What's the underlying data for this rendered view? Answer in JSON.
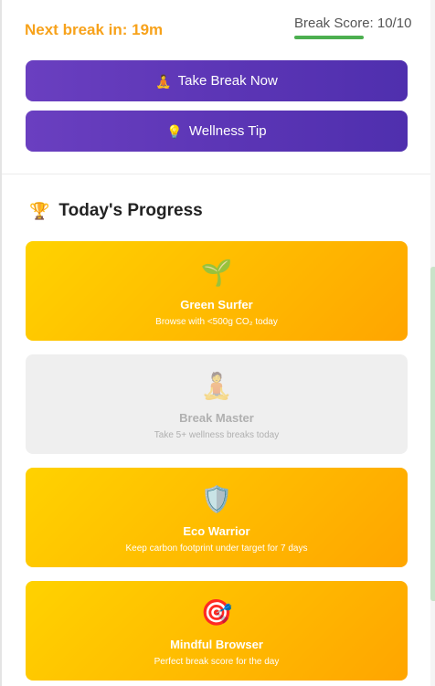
{
  "status": {
    "next_break": "Next break in: 19m",
    "score_label": "Break Score: 10/10",
    "score_fraction": 1.0,
    "score_color": "#4caf50"
  },
  "buttons": {
    "take_break": {
      "icon": "meditation-icon",
      "emoji": "🧘",
      "label": "Take Break Now"
    },
    "wellness_tip": {
      "icon": "lightbulb-icon",
      "emoji": "💡",
      "label": "Wellness Tip"
    }
  },
  "progress": {
    "icon": "trophy-icon",
    "emoji": "🏆",
    "title": "Today's Progress",
    "achievements": [
      {
        "icon": "seedling-icon",
        "emoji": "🌱",
        "title": "Green Surfer",
        "desc": "Browse with <500g CO₂ today",
        "earned": true
      },
      {
        "icon": "meditation-icon",
        "emoji": "🧘",
        "title": "Break Master",
        "desc": "Take 5+ wellness breaks today",
        "earned": false
      },
      {
        "icon": "shield-icon",
        "emoji": "🛡️",
        "title": "Eco Warrior",
        "desc": "Keep carbon footprint under target for 7 days",
        "earned": true
      },
      {
        "icon": "target-icon",
        "emoji": "🎯",
        "title": "Mindful Browser",
        "desc": "Perfect break score for the day",
        "earned": true
      }
    ]
  },
  "colors": {
    "accent_orange": "#f7a21b",
    "button_purple": "#5b35b5",
    "card_gold": "#ffbe00"
  }
}
